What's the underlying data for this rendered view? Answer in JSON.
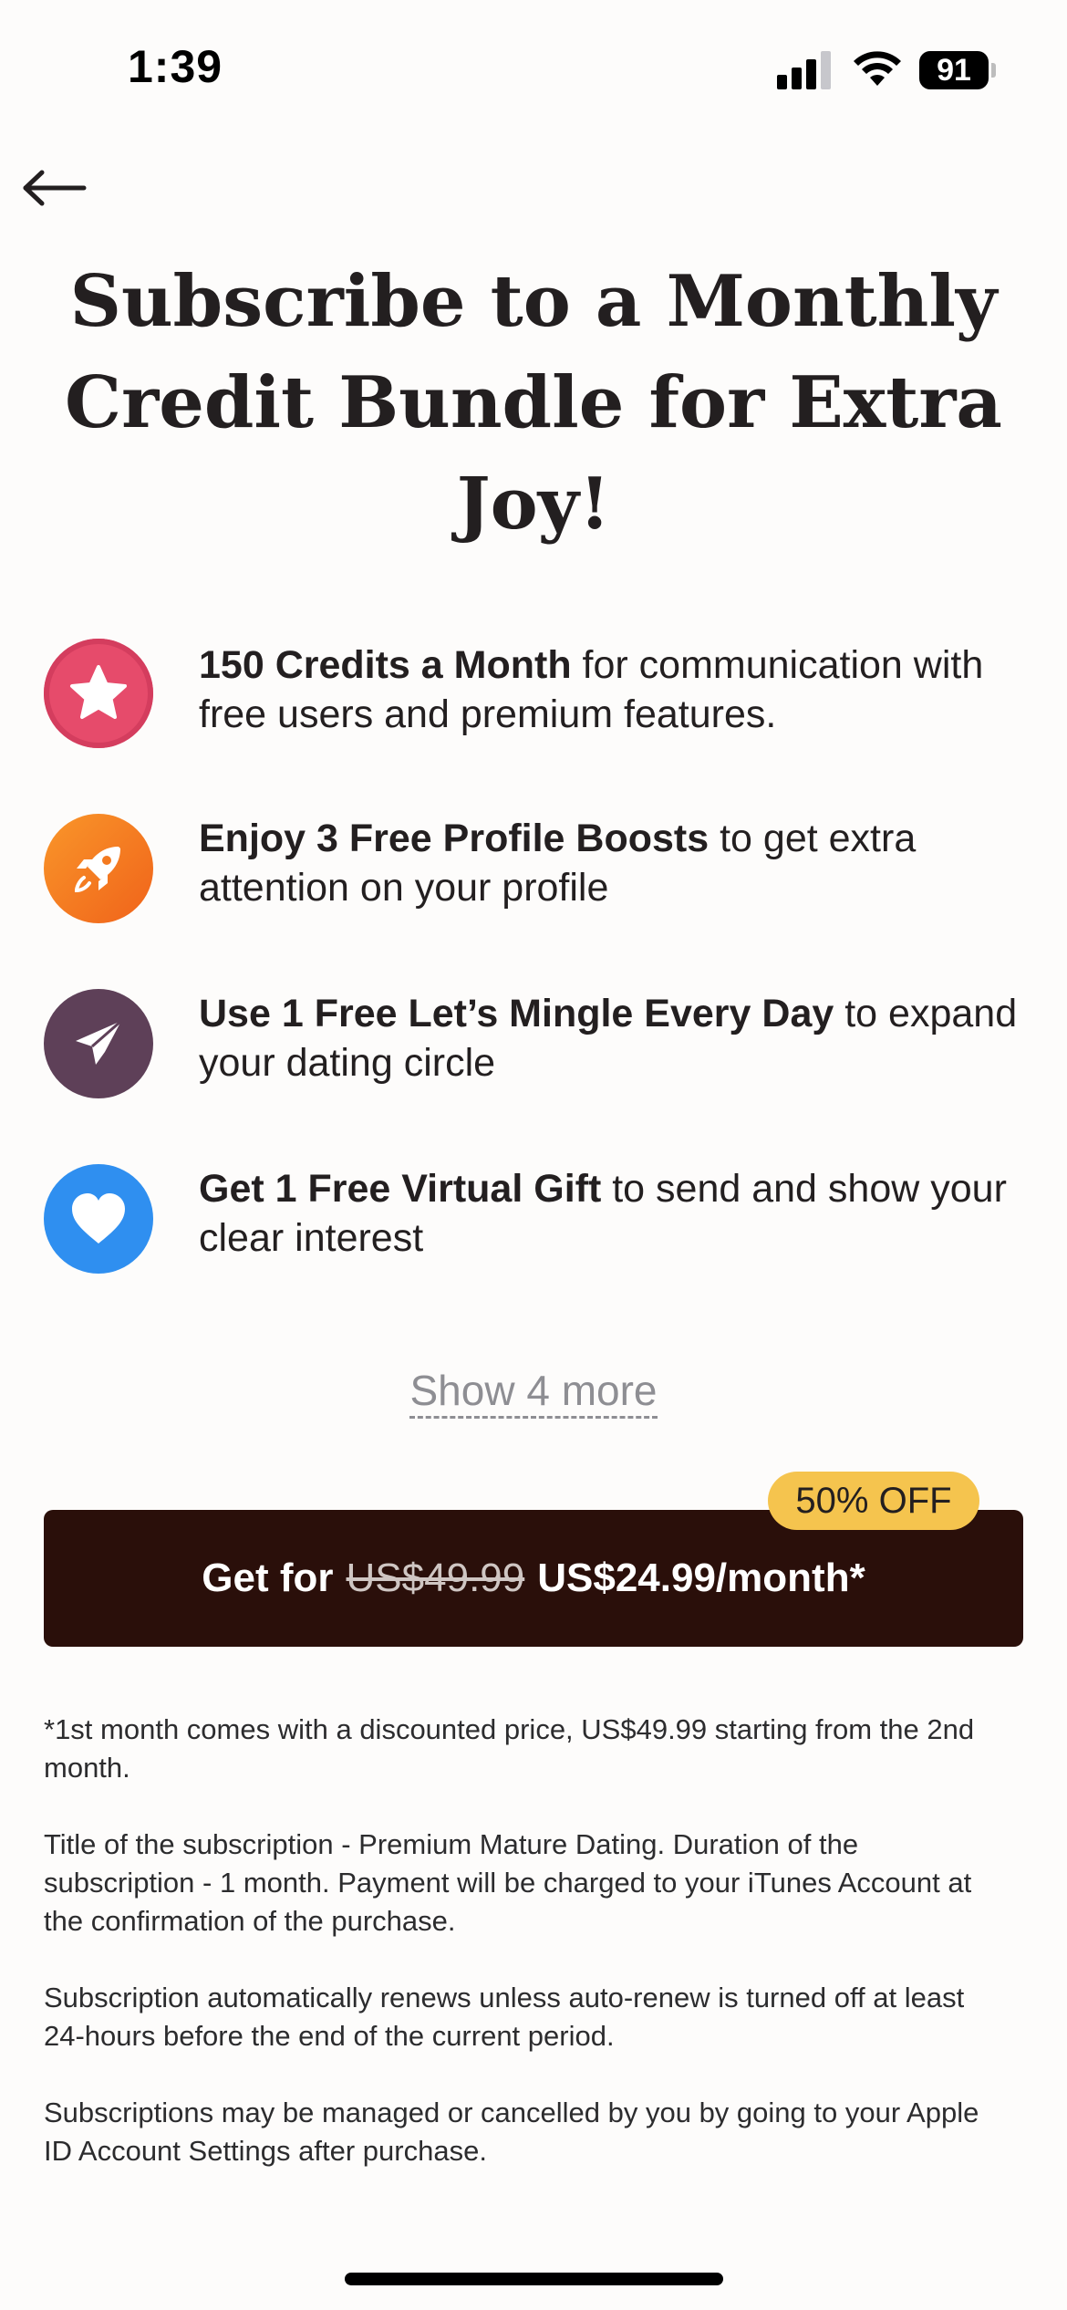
{
  "status_bar": {
    "time": "1:39",
    "battery": "91",
    "icons": [
      "signal-icon",
      "wifi-icon",
      "battery-icon"
    ]
  },
  "nav": {
    "back_icon": "arrow-left-icon"
  },
  "title": "Subscribe to a Monthly Credit Bundle for Extra Joy!",
  "features": [
    {
      "icon": "star-icon",
      "color": "#e64b6b",
      "bold": "150 Credits a Month",
      "rest": " for communication with free users and premium features."
    },
    {
      "icon": "rocket-icon",
      "color": "#f47a1f",
      "bold": "Enjoy 3 Free Profile Boosts",
      "rest": " to get extra attention on your profile"
    },
    {
      "icon": "paper-plane-icon",
      "color": "#5e4058",
      "bold": "Use 1 Free Let’s Mingle Every Day",
      "rest": " to expand your dating circle"
    },
    {
      "icon": "heart-icon",
      "color": "#2f8ff0",
      "bold": "Get 1 Free Virtual Gift",
      "rest": " to send and show your clear interest"
    }
  ],
  "show_more": "Show 4 more",
  "cta": {
    "prefix": "Get for",
    "old_price": "US$49.99",
    "new_price": "US$24.99/month*",
    "badge": "50% OFF",
    "button_color": "#2a0f0a",
    "badge_color": "#f5c44e"
  },
  "legal": [
    "*1st month comes with a discounted price, US$49.99 starting from the 2nd month.",
    "Title of the subscription - Premium Mature Dating. Duration of the subscription - 1 month. Payment will be charged to your iTunes Account at the confirmation of the purchase.",
    "Subscription automatically renews unless auto-renew is turned off at least 24-hours before the end of the current period.",
    "Subscriptions may be managed or cancelled by you by going to your Apple ID Account Settings after purchase."
  ]
}
